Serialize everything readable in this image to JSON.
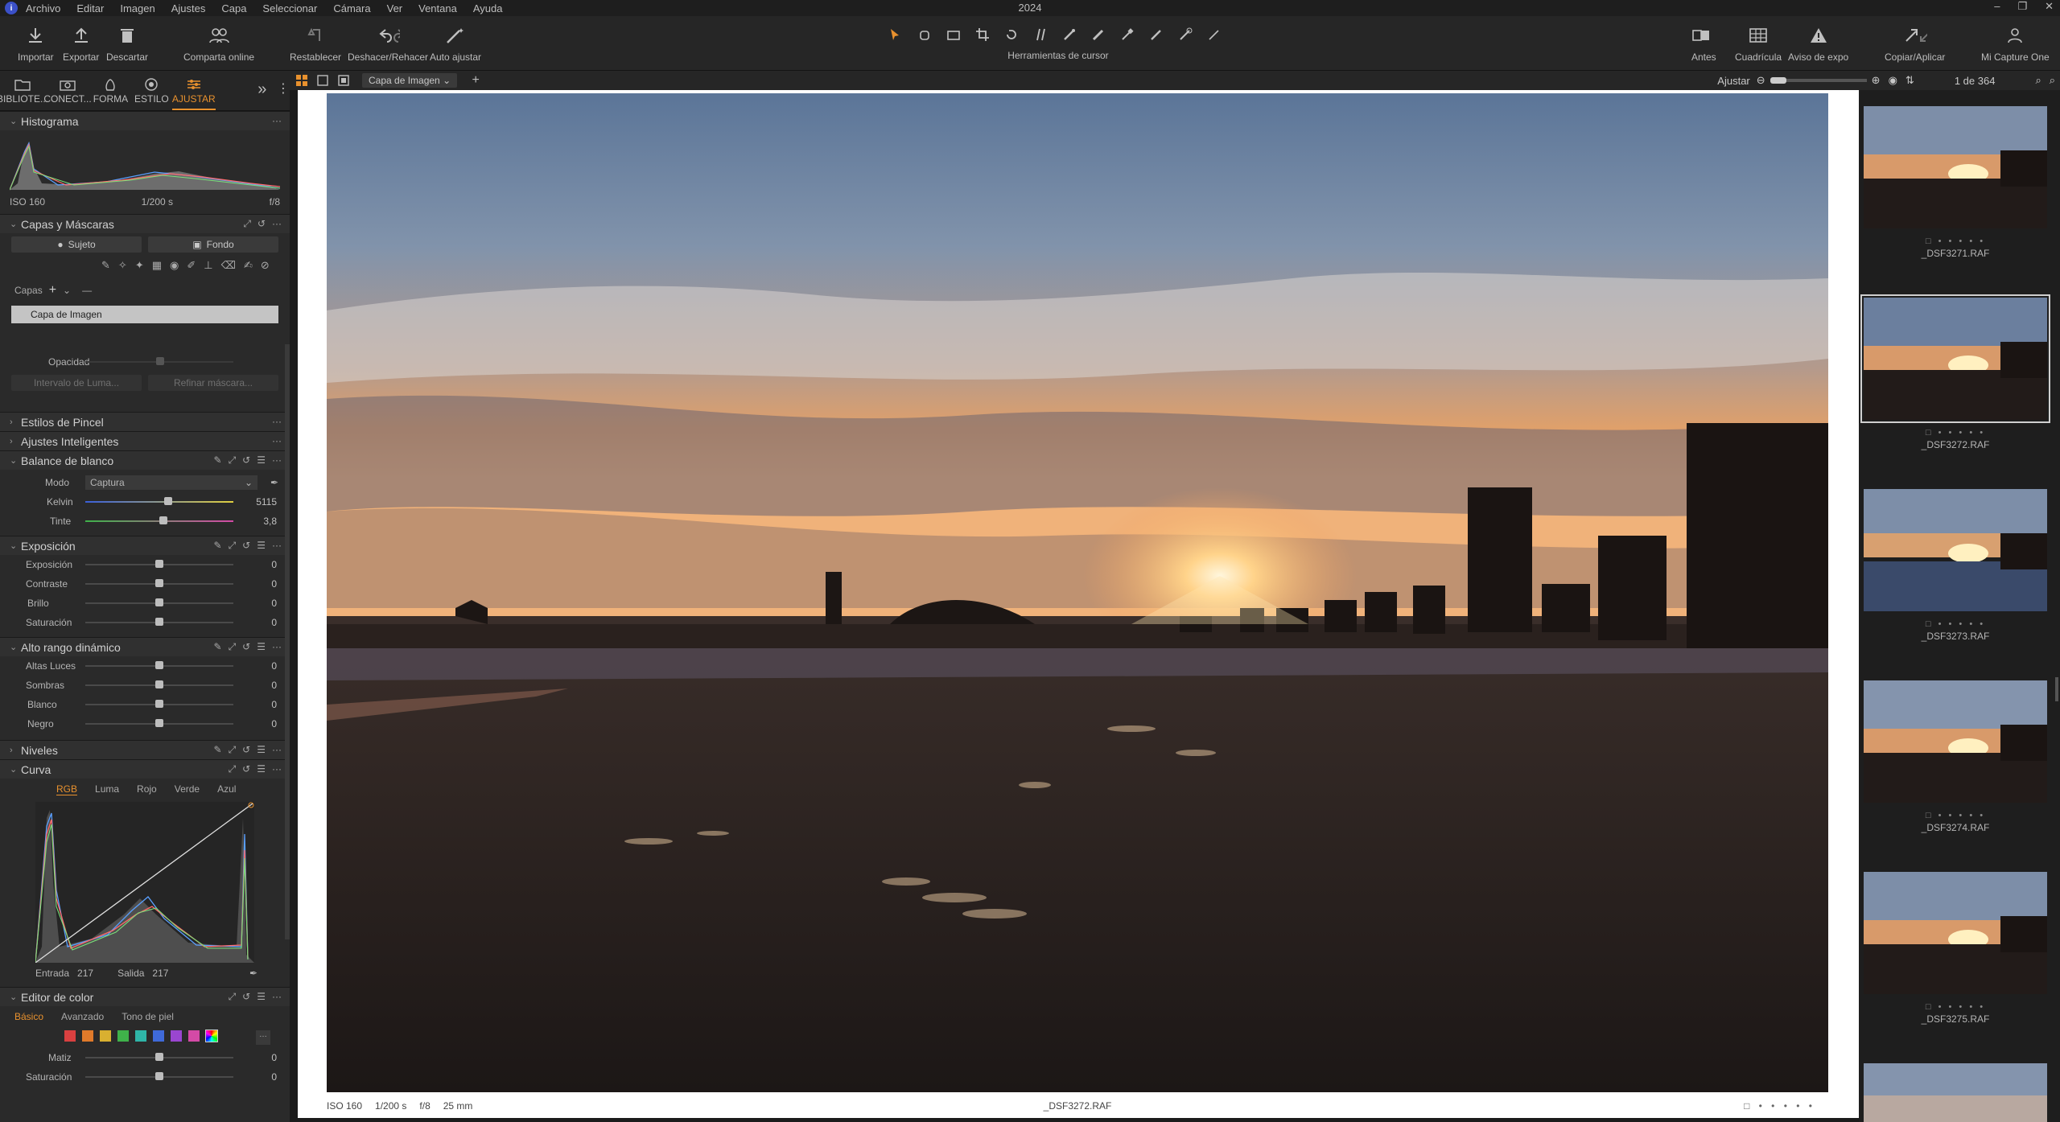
{
  "app": {
    "title": "2024",
    "menu": [
      "Archivo",
      "Editar",
      "Imagen",
      "Ajustes",
      "Capa",
      "Seleccionar",
      "Cámara",
      "Ver",
      "Ventana",
      "Ayuda"
    ]
  },
  "toolbar": {
    "import": "Importar",
    "export": "Exportar",
    "discard": "Descartar",
    "share": "Comparta online",
    "reset": "Restablecer",
    "undo_redo": "Deshacer/Rehacer",
    "auto": "Auto ajustar",
    "cursor_tools": "Herramientas de cursor",
    "before": "Antes",
    "grid": "Cuadrícula",
    "exposure_warning": "Aviso de expo",
    "copy_apply": "Copiar/Aplicar",
    "account": "Mi Capture One"
  },
  "tool_tabs": [
    {
      "label": "BIBLIOTE...",
      "icon": "library-icon"
    },
    {
      "label": "CONECT...",
      "icon": "camera-icon"
    },
    {
      "label": "FORMA",
      "icon": "lens-icon"
    },
    {
      "label": "ESTILO",
      "icon": "style-icon"
    },
    {
      "label": "AJUSTAR",
      "icon": "adjust-icon"
    }
  ],
  "viewer_bar": {
    "layer": "Capa de Imagen",
    "fit": "Ajustar",
    "counter": "1 de 364"
  },
  "histogram": {
    "title": "Histograma",
    "iso": "ISO 160",
    "shutter": "1/200 s",
    "aperture": "f/8"
  },
  "layers": {
    "title": "Capas y Máscaras",
    "subject": "Sujeto",
    "background": "Fondo",
    "layers_label": "Capas",
    "layer_name": "Capa de Imagen",
    "opacity": "Opacidad",
    "luma_range": "Intervalo de Luma...",
    "refine_mask": "Refinar máscara..."
  },
  "brush_styles": "Estilos de Pincel",
  "smart_adjust": "Ajustes Inteligentes",
  "white_balance": {
    "title": "Balance de blanco",
    "mode_label": "Modo",
    "mode_value": "Captura",
    "kelvin_label": "Kelvin",
    "kelvin_value": "5115",
    "tint_label": "Tinte",
    "tint_value": "3,8"
  },
  "exposure": {
    "title": "Exposición",
    "rows": [
      {
        "label": "Exposición",
        "value": "0"
      },
      {
        "label": "Contraste",
        "value": "0"
      },
      {
        "label": "Brillo",
        "value": "0"
      },
      {
        "label": "Saturación",
        "value": "0"
      }
    ]
  },
  "hdr": {
    "title": "Alto rango dinámico",
    "rows": [
      {
        "label": "Altas Luces",
        "value": "0"
      },
      {
        "label": "Sombras",
        "value": "0"
      },
      {
        "label": "Blanco",
        "value": "0"
      },
      {
        "label": "Negro",
        "value": "0"
      }
    ]
  },
  "levels": "Niveles",
  "curve": {
    "title": "Curva",
    "tabs": [
      "RGB",
      "Luma",
      "Rojo",
      "Verde",
      "Azul"
    ],
    "input_label": "Entrada",
    "input_value": "217",
    "output_label": "Salida",
    "output_value": "217"
  },
  "color_editor": {
    "title": "Editor de color",
    "tabs": [
      "Básico",
      "Avanzado",
      "Tono de piel"
    ],
    "hue_label": "Matiz",
    "hue_value": "0",
    "sat_label": "Saturación",
    "sat_value": "0",
    "swatches": [
      "#d94040",
      "#e07a2a",
      "#d9b030",
      "#3fb24a",
      "#2fb5a8",
      "#3f6ad9",
      "#9a46d0",
      "#d44aa6"
    ]
  },
  "photo_info": {
    "iso": "ISO 160",
    "shutter": "1/200 s",
    "aperture": "f/8",
    "focal": "25 mm",
    "filename": "_DSF3272.RAF"
  },
  "thumbnails": [
    {
      "name": "_DSF3271.RAF",
      "selected": false
    },
    {
      "name": "_DSF3272.RAF",
      "selected": true
    },
    {
      "name": "_DSF3273.RAF",
      "selected": false
    },
    {
      "name": "_DSF3274.RAF",
      "selected": false
    },
    {
      "name": "_DSF3275.RAF",
      "selected": false
    }
  ],
  "colors": {
    "accent": "#e8912e",
    "panel": "#2a2a2a",
    "toolbar": "#262626"
  }
}
